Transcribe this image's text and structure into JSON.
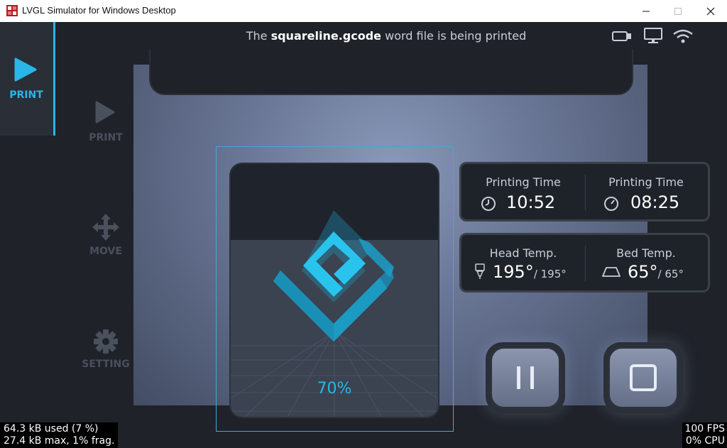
{
  "window": {
    "title": "LVGL Simulator for Windows Desktop"
  },
  "header": {
    "prefix": "The",
    "filename": "squareline.gcode",
    "suffix": "word file is being printed"
  },
  "sidebar": {
    "active_label": "PRINT",
    "items": [
      {
        "label": "PRINT",
        "icon": "play-icon"
      },
      {
        "label": "MOVE",
        "icon": "move-arrows-icon"
      },
      {
        "label": "SETTING",
        "icon": "gear-icon"
      }
    ]
  },
  "times": {
    "left_label": "Printing Time",
    "left_value": "10:52",
    "right_label": "Printing Time",
    "right_value": "08:25"
  },
  "temps": {
    "head_label": "Head Temp.",
    "head_value": "195°",
    "head_target": "/ 195°",
    "bed_label": "Bed Temp.",
    "bed_value": "65°",
    "bed_target": "/ 65°"
  },
  "progress": {
    "percent_text": "70%",
    "fraction": 0.7
  },
  "stats": {
    "mem_used": "64.3 kB used (7 %)",
    "mem_max": "27.4 kB max, 1% frag.",
    "fps": "100 FPS",
    "cpu": "0% CPU"
  },
  "colors": {
    "accent": "#29b6e8",
    "background": "#1f2229"
  }
}
